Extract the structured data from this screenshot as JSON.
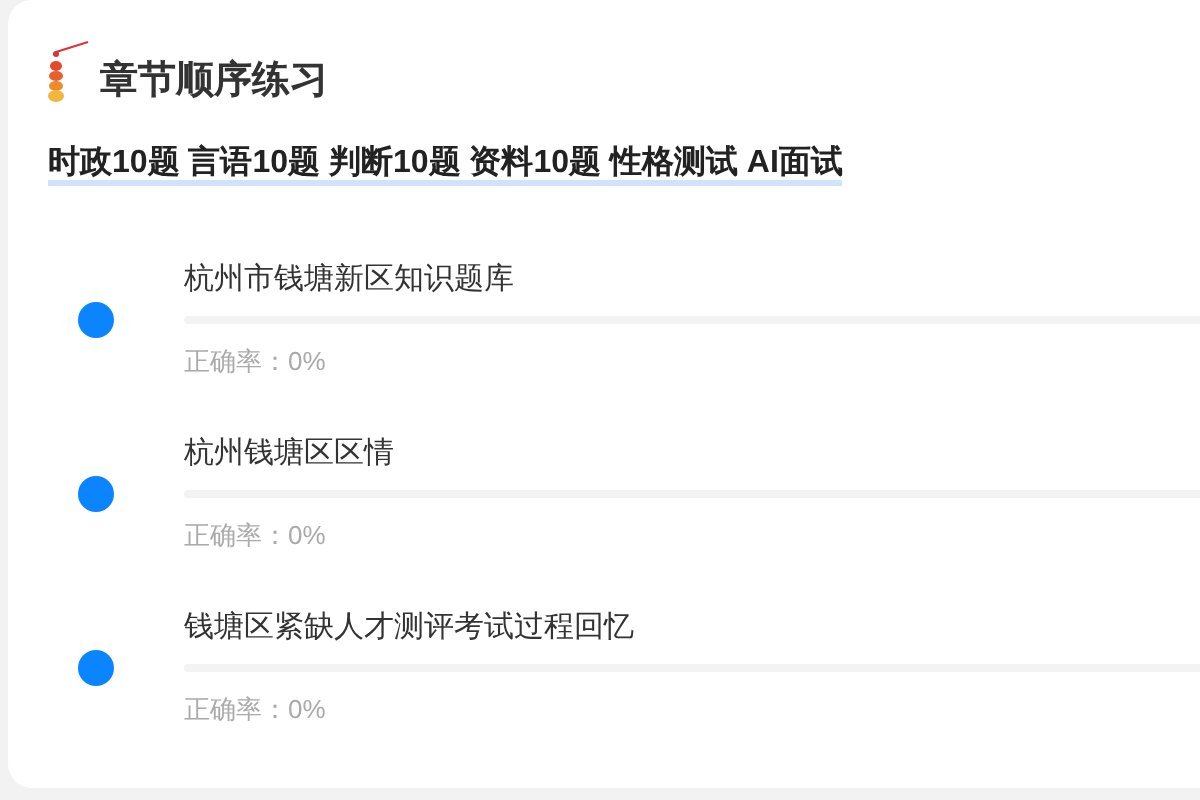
{
  "title": "章节顺序练习",
  "subheader": "时政10题 言语10题 判断10题 资料10题 性格测试 AI面试",
  "chapters": [
    {
      "name": "杭州市钱塘新区知识题库",
      "level": 0,
      "accuracy": "正确率：0%"
    },
    {
      "name": "杭州钱塘区区情",
      "level": 0,
      "accuracy": "正确率：0%"
    },
    {
      "name": "钱塘区紧缺人才测评考试过程回忆",
      "level": 0,
      "accuracy": "正确率：0%"
    }
  ]
}
